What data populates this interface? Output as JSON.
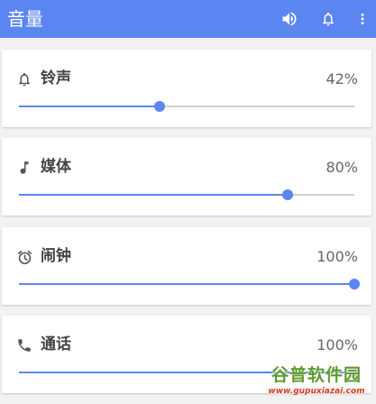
{
  "appbar": {
    "title": "音量",
    "actions": [
      {
        "icon": "volume-icon"
      },
      {
        "icon": "bell-icon"
      },
      {
        "icon": "more-vert-icon"
      }
    ]
  },
  "colors": {
    "accent": "#5b86f1",
    "track": "#d0d0d0"
  },
  "cards": [
    {
      "icon": "bell-outline-icon",
      "label": "铃声",
      "value_text": "42%",
      "level": 0.42
    },
    {
      "icon": "music-note-icon",
      "label": "媒体",
      "value_text": "80%",
      "level": 0.8
    },
    {
      "icon": "alarm-clock-icon",
      "label": "闹钟",
      "value_text": "100%",
      "level": 1.0
    },
    {
      "icon": "phone-icon",
      "label": "通话",
      "value_text": "100%",
      "level": 1.0
    }
  ],
  "watermark": {
    "main": "谷普软件园",
    "url": "www.gupuxiazai.com"
  }
}
